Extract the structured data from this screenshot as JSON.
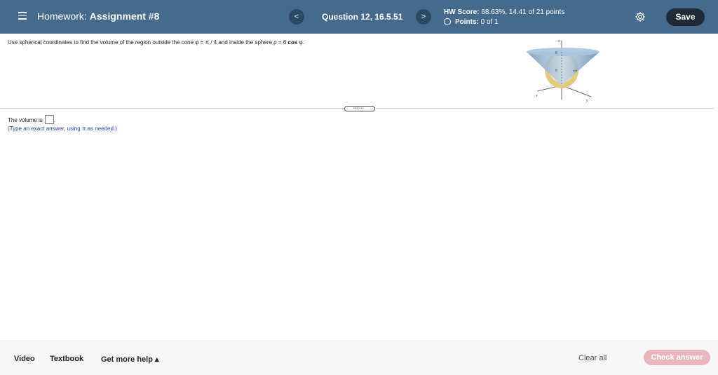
{
  "header": {
    "hw_prefix": "Homework:",
    "assignment": "Assignment #8",
    "prev_glyph": "<",
    "next_glyph": ">",
    "question": "Question 12, 16.5.51",
    "score_label": "HW Score:",
    "score_value": "68.63%, 14.41 of 21 points",
    "points_label": "Points:",
    "points_value": "0 of 1",
    "save": "Save"
  },
  "question": {
    "text_part1": "Use spherical coordinates to find the volume of the region outside the cone φ = π / 4 and inside the sphere ρ = 6 ",
    "text_bold": "cos",
    "text_part2": " φ.",
    "figure": {
      "z_label": "z",
      "x_label": "x",
      "y_label": "y",
      "label_a": "6",
      "label_b": "6",
      "label_c": "π/4"
    }
  },
  "answer": {
    "prefix": "The volume is",
    "suffix": ".",
    "hint": "(Type an exact answer, using π as needed.)"
  },
  "footer": {
    "video": "Video",
    "textbook": "Textbook",
    "help": "Get more help ▴",
    "clear": "Clear all",
    "check": "Check answer"
  },
  "colors": {
    "header_bg": "#456a8c",
    "save_bg": "#1f2a36",
    "check_bg": "#e8b7bd",
    "hint_text": "#2a3f9e"
  }
}
